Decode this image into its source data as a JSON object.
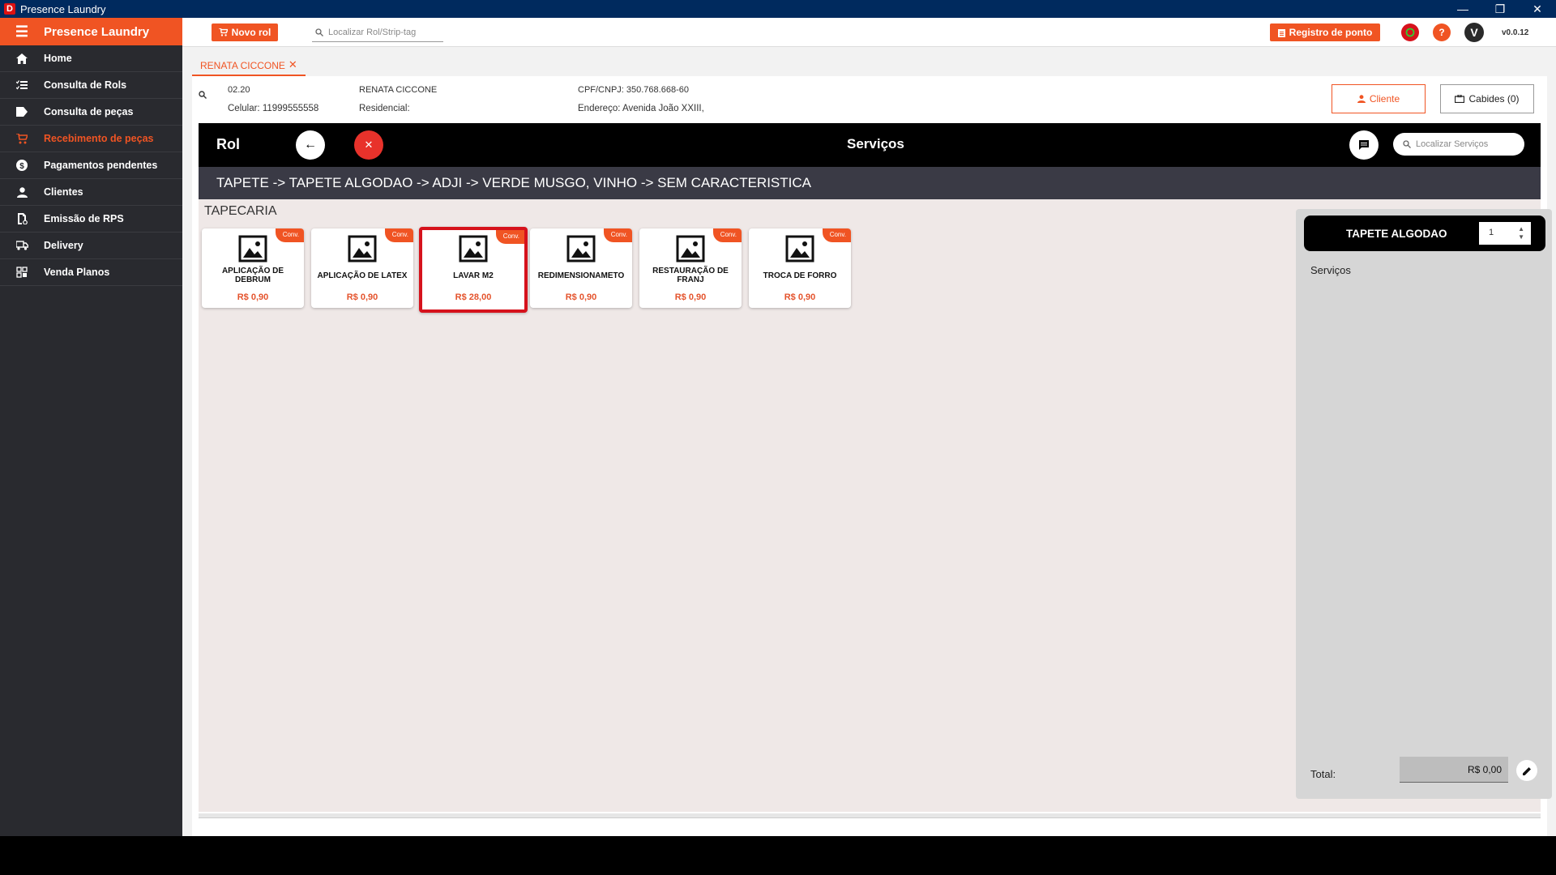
{
  "window": {
    "title": "Presence Laundry"
  },
  "sidebar": {
    "brand": "Presence Laundry",
    "items": [
      {
        "label": "Home",
        "icon": "home-icon"
      },
      {
        "label": "Consulta de Rols",
        "icon": "list-check-icon"
      },
      {
        "label": "Consulta de peças",
        "icon": "tag-icon"
      },
      {
        "label": "Recebimento de peças",
        "icon": "cart-icon",
        "active": true
      },
      {
        "label": "Pagamentos pendentes",
        "icon": "dollar-circle-icon"
      },
      {
        "label": "Clientes",
        "icon": "person-icon"
      },
      {
        "label": "Emissão de RPS",
        "icon": "document-icon"
      },
      {
        "label": "Delivery",
        "icon": "truck-icon"
      },
      {
        "label": "Venda Planos",
        "icon": "plans-icon"
      }
    ]
  },
  "topbar": {
    "new_rol_label": "Novo rol",
    "search_placeholder": "Localizar Rol/Strip-tag",
    "registro_label": "Registro de ponto",
    "avatar_letter": "V",
    "version": "v0.0.12",
    "colors": {
      "accent": "#f05423",
      "whatsapp": "#d6121c"
    }
  },
  "tab": {
    "label": "RENATA CICCONE"
  },
  "client": {
    "code": "02.20",
    "name": "RENATA CICCONE",
    "cpf": "CPF/CNPJ: 350.768.668-60",
    "celular": "Celular: 11999555558",
    "residencial": "Residencial:",
    "endereco": "Endereço: Avenida João XXIII,",
    "cliente_button": "Cliente",
    "cabides_button": "Cabides (0)"
  },
  "rol": {
    "title": "Rol",
    "servicos_title": "Serviços",
    "search_placeholder": "Localizar Serviços",
    "breadcrumb": "TAPETE -> TAPETE ALGODAO -> ADJI -> VERDE MUSGO, VINHO -> SEM CARACTERISTICA"
  },
  "category": {
    "title": "TAPECARIA",
    "badge": "Conv.",
    "services": [
      {
        "name": "APLICAÇÃO DE DEBRUM",
        "price": "R$ 0,90"
      },
      {
        "name": "APLICAÇÃO DE LATEX",
        "price": "R$ 0,90"
      },
      {
        "name": "LAVAR M2",
        "price": "R$ 28,00",
        "selected": true
      },
      {
        "name": "REDIMENSIONAMETO",
        "price": "R$ 0,90"
      },
      {
        "name": "RESTAURAÇÃO DE FRANJ",
        "price": "R$ 0,90"
      },
      {
        "name": "TROCA DE FORRO",
        "price": "R$ 0,90"
      }
    ]
  },
  "summary": {
    "item_name": "TAPETE ALGODAO",
    "quantity": "1",
    "servicos_label": "Serviços",
    "total_label": "Total:",
    "total_value": "R$ 0,00"
  }
}
